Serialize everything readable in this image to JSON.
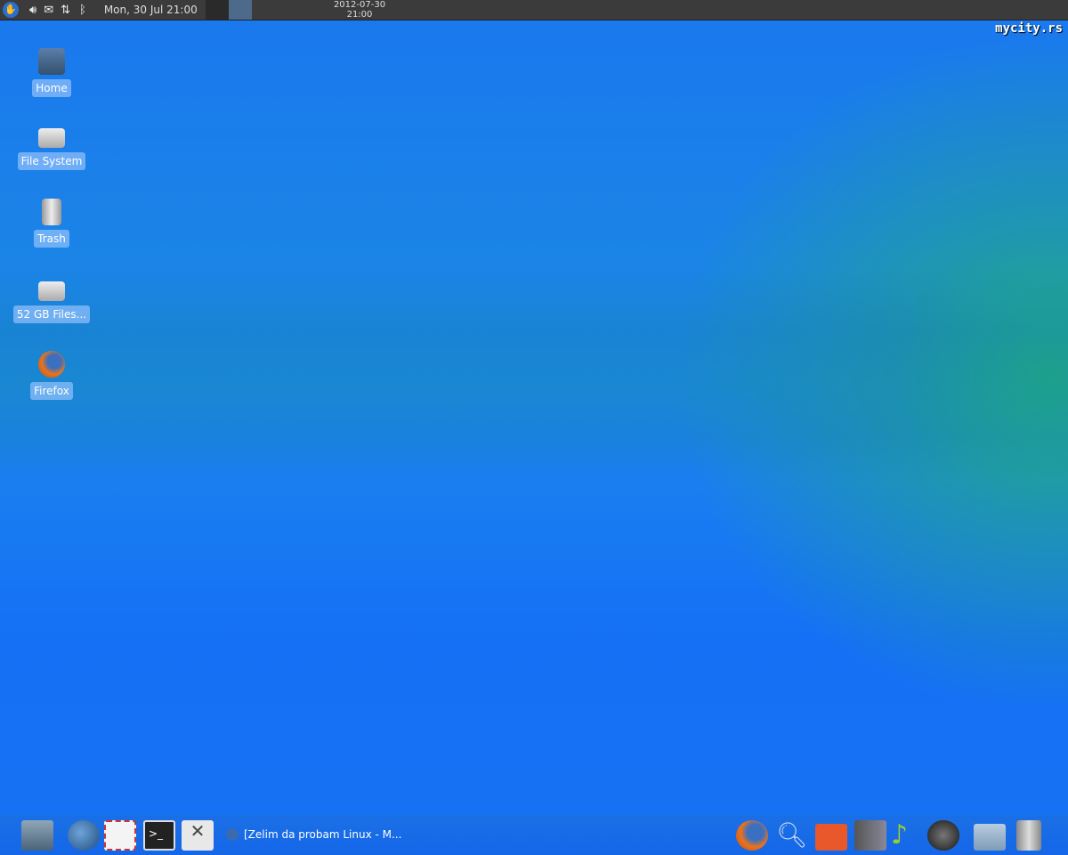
{
  "top_panel": {
    "menu_icon": "xfce-mouse-icon",
    "tray": [
      "volume-icon",
      "mail-icon",
      "network-icon",
      "bluetooth-icon"
    ],
    "clock": "Mon, 30 Jul  21:00",
    "date2": "2012-07-30",
    "time2": "21:00",
    "workspaces": 2
  },
  "desktop": {
    "icons": [
      {
        "label": "Home",
        "icon": "home-folder-icon"
      },
      {
        "label": "File System",
        "icon": "drive-icon"
      },
      {
        "label": "Trash",
        "icon": "trash-icon"
      },
      {
        "label": "52 GB Files...",
        "icon": "drive-icon"
      },
      {
        "label": "Firefox",
        "icon": "firefox-icon"
      }
    ]
  },
  "bottom_panel": {
    "launchers": [
      "show-desktop-icon",
      "web-browser-icon",
      "mail-client-icon",
      "terminal-icon",
      "settings-icon"
    ],
    "task": "[Zelim da probam Linux - M...",
    "dock": [
      "firefox-icon",
      "search-icon",
      "software-center-icon",
      "text-editor-icon",
      "music-player-icon",
      "gimp-icon",
      "file-manager-icon",
      "trash-icon"
    ]
  },
  "watermark": "mycity.rs"
}
